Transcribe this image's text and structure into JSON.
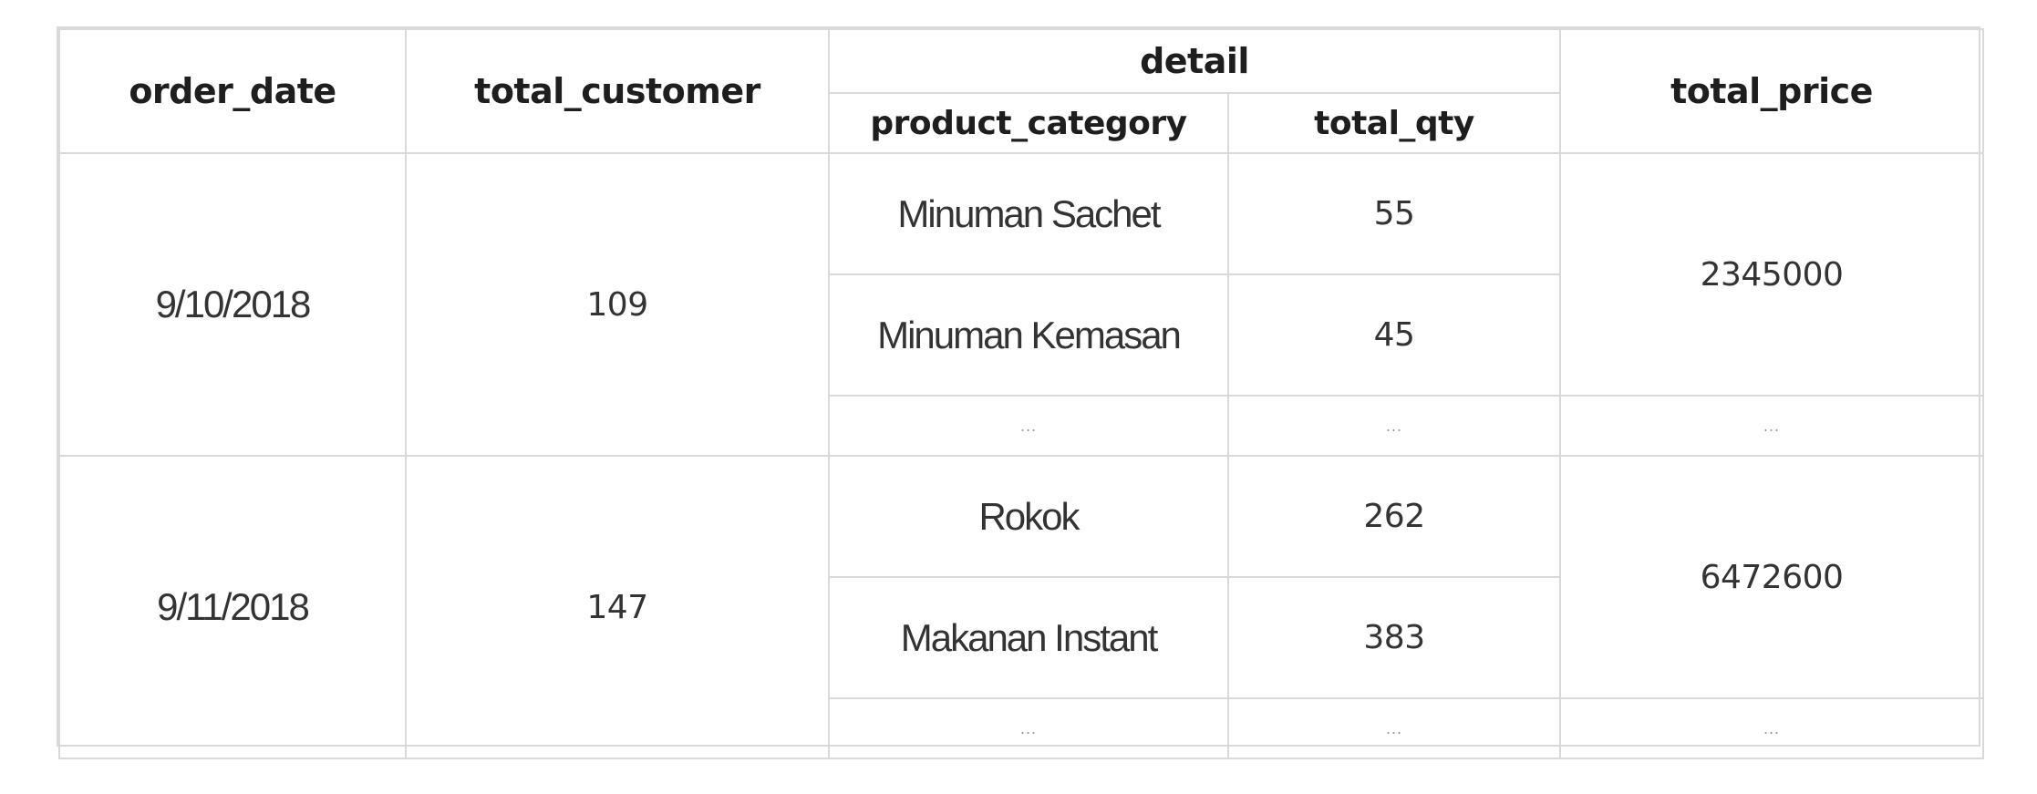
{
  "table": {
    "headers": {
      "order_date": "order_date",
      "total_customer": "total_customer",
      "detail": "detail",
      "product_category": "product_category",
      "total_qty": "total_qty",
      "total_price": "total_price"
    },
    "groups": [
      {
        "order_date": "9/10/2018",
        "total_customer": "109",
        "total_price": "2345000",
        "items": [
          {
            "product_category": "Minuman Sachet",
            "total_qty": "55"
          },
          {
            "product_category": "Minuman Kemasan",
            "total_qty": "45"
          }
        ],
        "more": {
          "product_category": "...",
          "total_qty": "...",
          "total_price": "..."
        }
      },
      {
        "order_date": "9/11/2018",
        "total_customer": "147",
        "total_price": "6472600",
        "items": [
          {
            "product_category": "Rokok",
            "total_qty": "262"
          },
          {
            "product_category": "Makanan Instant",
            "total_qty": "383"
          }
        ],
        "more": {
          "product_category": "...",
          "total_qty": "...",
          "total_price": "..."
        }
      }
    ]
  }
}
